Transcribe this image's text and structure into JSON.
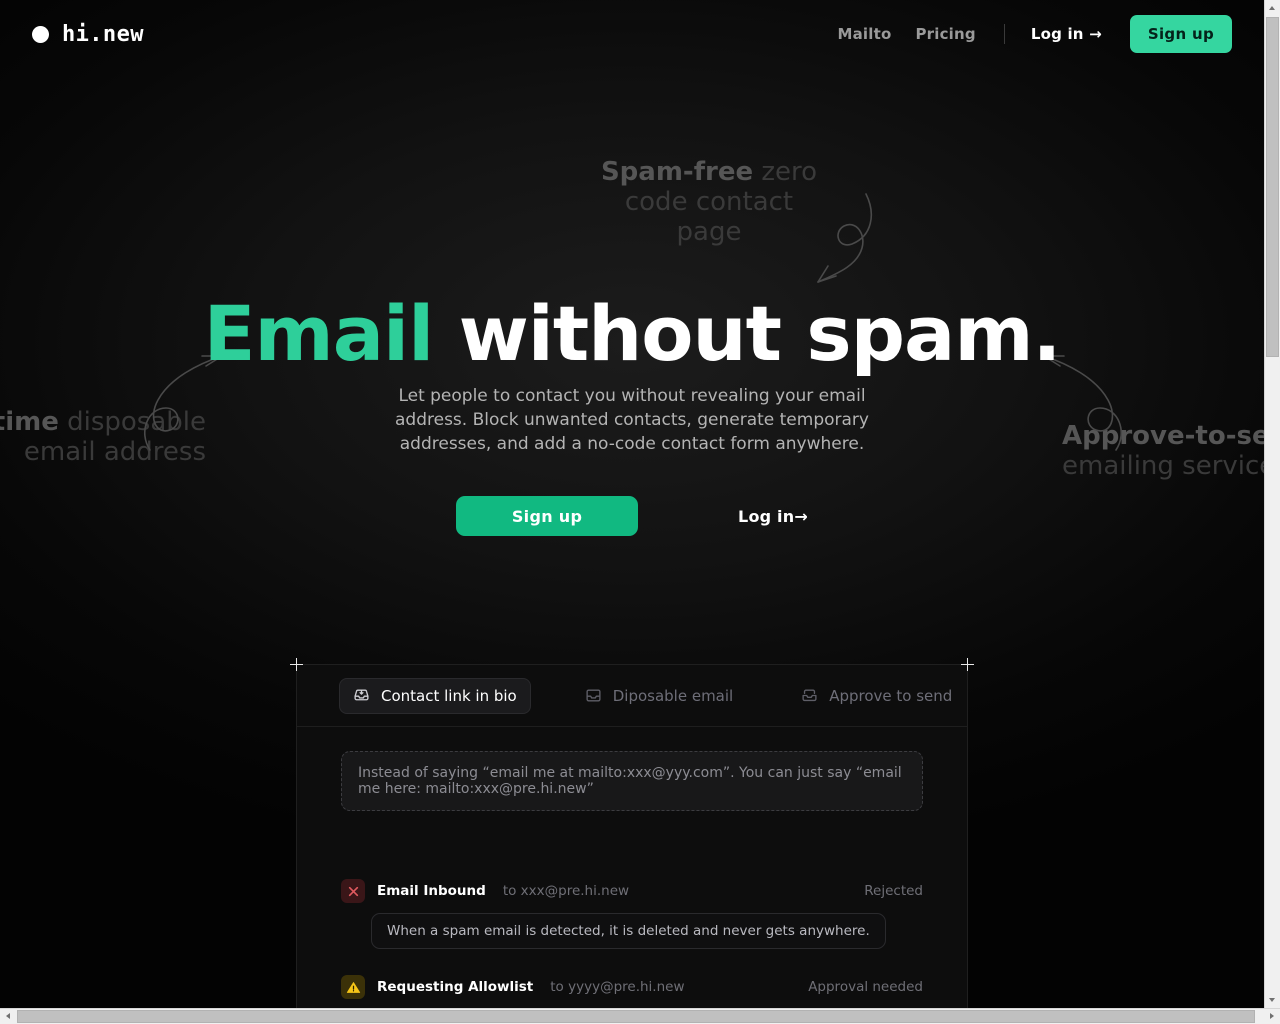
{
  "header": {
    "brand": "hi.new",
    "brand_icon": "circle-dot-icon",
    "nav": [
      {
        "label": "Mailto"
      },
      {
        "label": "Pricing"
      }
    ],
    "login_label": "Log in →",
    "signup_label": "Sign up"
  },
  "hero": {
    "title_accent": "Email",
    "title_rest": " without spam.",
    "subtitle": "Let people to contact you without revealing your email address. Block unwanted contacts, generate temporary addresses, and add a no-code contact form anywhere.",
    "cta_primary": "Sign up",
    "cta_secondary": "Log in→",
    "ghost_top_strong": "Spam-free",
    "ghost_top_rest": " zero code contact page",
    "ghost_left_strong": "e-time",
    "ghost_left_rest": " disposable email address",
    "ghost_right_strong": "Approve-to-send",
    "ghost_right_rest": "emailing service"
  },
  "demo": {
    "tabs": [
      {
        "label": "Contact link in bio",
        "icon": "inbox-download-icon",
        "active": true
      },
      {
        "label": "Diposable email",
        "icon": "inbox-icon",
        "active": false
      },
      {
        "label": "Approve to send",
        "icon": "inbox-stack-icon",
        "active": false
      }
    ],
    "note": "Instead of saying “email me at mailto:xxx@yyy.com”. You can just say “email me here: mailto:xxx@pre.hi.new”",
    "events": [
      {
        "icon": "close-x-icon",
        "title": "Email Inbound",
        "target": "to xxx@pre.hi.new",
        "status": "Rejected",
        "message": "When a spam email is detected, it is deleted and never gets anywhere."
      },
      {
        "icon": "warning-triangle-icon",
        "title": "Requesting Allowlist",
        "target": "to yyyy@pre.hi.new",
        "status": "Approval needed",
        "message": ""
      }
    ]
  },
  "colors": {
    "accent_green": "#11b981",
    "nav_green": "#35d6a0",
    "title_green": "#2ecf9a",
    "background": "#050505",
    "reject_red": "#e05a5f",
    "warn_yellow": "#f5c518"
  }
}
